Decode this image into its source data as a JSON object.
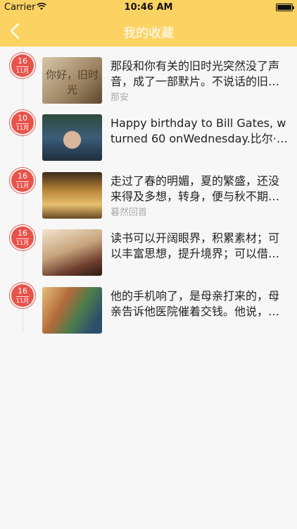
{
  "status": {
    "carrier": "Carrier",
    "time": "10:46 AM"
  },
  "nav": {
    "title": "我的收藏"
  },
  "items": [
    {
      "day": "16",
      "month": "11月",
      "line1": "那段和你有关的旧时光突然没了声",
      "line2": "音，成了一部默片。不说话的旧…",
      "author": "那安",
      "thumb_text": "你好，旧时光",
      "thumb_icon": "old-paper-photo"
    },
    {
      "day": "10",
      "month": "11月",
      "line1": "Happy birthday to Bill Gates, who",
      "line2": "turned 60 onWednesday.比尔·…",
      "author": "",
      "thumb_icon": "portrait-photo"
    },
    {
      "day": "16",
      "month": "11月",
      "line1": "走过了春的明媚，夏的繁盛，还没",
      "line2": "来得及多想，转身，便与秋不期…",
      "author": "暮然回首",
      "thumb_icon": "golden-interior-photo"
    },
    {
      "day": "16",
      "month": "11月",
      "line1": "读书可以开阔眼界，积累素材；可",
      "line2": "以丰富思想，提升境界；可以借…",
      "author": "",
      "thumb_icon": "book-figures-photo"
    },
    {
      "day": "16",
      "month": "11月",
      "line1": "他的手机响了，是母亲打来的，母",
      "line2": "亲告诉他医院催着交钱。他说，…",
      "author": "",
      "thumb_icon": "painted-street-photo"
    }
  ],
  "colors": {
    "accent": "#fcd262",
    "badge": "#e8534a"
  }
}
